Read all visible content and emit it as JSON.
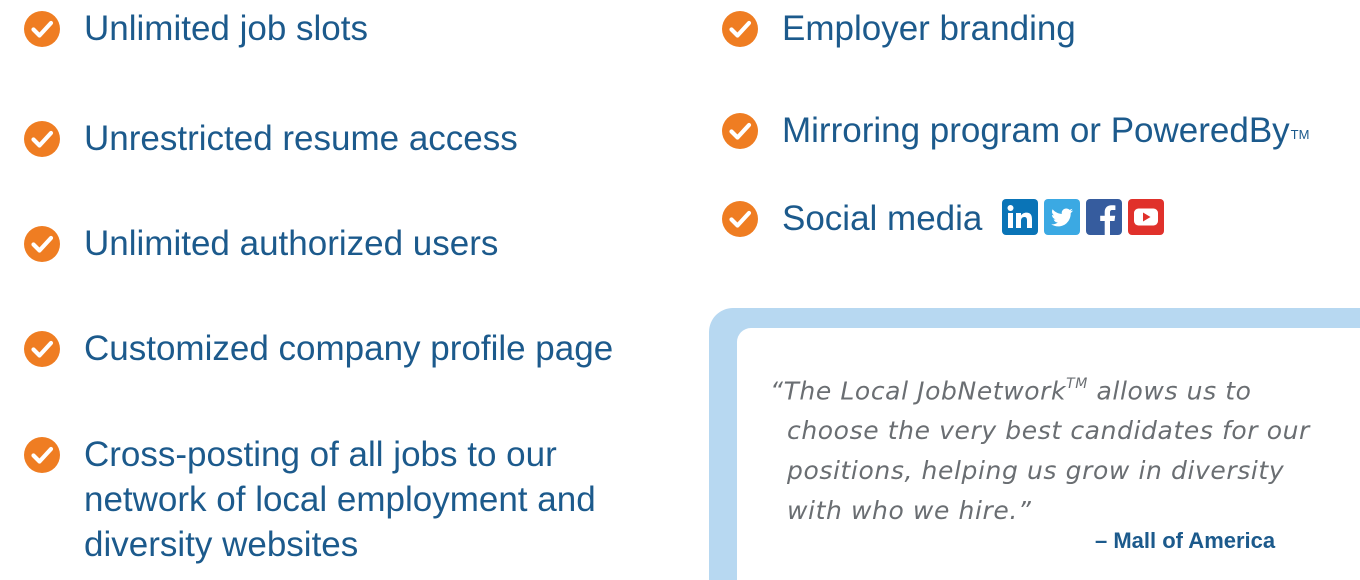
{
  "colors": {
    "text_blue": "#1c5a8c",
    "check_orange": "#ef7d22",
    "quote_box_blue": "#b7d8f1",
    "quote_gray": "#6a6e72",
    "linkedin": "#0a74b7",
    "twitter": "#3ba9e3",
    "facebook": "#365c9e",
    "youtube": "#e0312b"
  },
  "features_left": [
    {
      "label": "Unlimited job slots",
      "icon": "check-circle-icon"
    },
    {
      "label": "Unrestricted resume access",
      "icon": "check-circle-icon"
    },
    {
      "label": "Unlimited authorized users",
      "icon": "check-circle-icon"
    },
    {
      "label": "Customized company profile page",
      "icon": "check-circle-icon"
    },
    {
      "label": "Cross-posting of all jobs to our network of local employment and diversity websites",
      "icon": "check-circle-icon"
    }
  ],
  "features_right": [
    {
      "label": "Employer branding",
      "icon": "check-circle-icon"
    },
    {
      "label": "Mirroring program or PoweredBy",
      "trademark": "TM",
      "icon": "check-circle-icon"
    },
    {
      "label": "Social media",
      "icon": "check-circle-icon",
      "social_icons": [
        "linkedin-icon",
        "twitter-icon",
        "facebook-icon",
        "youtube-icon"
      ]
    }
  ],
  "quote": {
    "open_quote": "“",
    "line1_before_tm": "The Local JobNetwork",
    "line1_tm": "TM",
    "line1_after_tm": " allows us to",
    "line2": "choose the very best candidates for our",
    "line3": "positions, helping us grow in diversity",
    "line4": "with who we hire.”",
    "attribution": "– Mall of America"
  }
}
